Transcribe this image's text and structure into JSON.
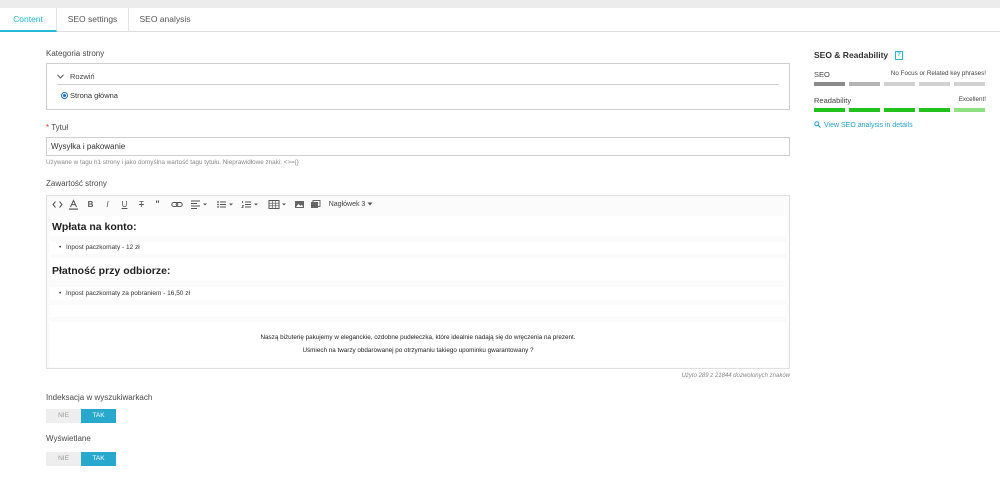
{
  "tabs": [
    "Content",
    "SEO settings",
    "SEO analysis"
  ],
  "active_tab": 0,
  "category": {
    "label": "Kategoria strony",
    "toggle_label": "Rozwiń",
    "selected_node": "Strona główna"
  },
  "title_field": {
    "label": "Tytuł",
    "required_mark": "*",
    "value": "Wysyłka i pakowanie",
    "help": "Używane w tagu h1 strony i jako domyślna wartość tagu tytułu. Nieprawidłowe znaki: <>={}"
  },
  "content_field": {
    "label": "Zawartość strony",
    "toolbar_heading": "Nagłówek 3",
    "toolbar_icons": [
      "code-icon",
      "text-color-icon",
      "bold-icon",
      "italic-icon",
      "underline-icon",
      "strikethrough-icon",
      "quote-icon",
      "link-icon",
      "align-icon",
      "bullet-list-icon",
      "numbered-list-icon",
      "table-icon",
      "image-icon",
      "media-icon"
    ],
    "heading_1": "Wpłata na konto:",
    "item_1": "Inpost paczkomaty - 12 zł",
    "heading_2": "Płatność przy odbiorze:",
    "item_2": "Inpost paczkomaty za pobraniem - 16,50 zł",
    "paragraph_1": "Naszą biżuterię pakujemy w eleganckie, ozdobne pudełeczka, które idealnie nadają się do wręczenia na prezent.",
    "paragraph_2": "Uśmiech na twarzy obdarowanej po otrzymaniu takiego upominku gwarantowany ?",
    "counter": "Użyto 289 z 21844 dozwolonych znaków"
  },
  "indexing": {
    "label": "Indeksacja w wyszukiwarkach",
    "off_label": "NIE",
    "on_label": "TAK",
    "value": "TAK"
  },
  "displayed": {
    "label": "Wyświetlane",
    "off_label": "NIE",
    "on_label": "TAK",
    "value": "TAK"
  },
  "seo_panel": {
    "title": "SEO & Readability",
    "help_icon": "?",
    "seo_label": "SEO",
    "seo_status": "No Focus or Related key phrases!",
    "readability_label": "Readability",
    "readability_status": "Excellent!",
    "link_label": "View SEO analysis in details",
    "colors": {
      "seo_bars": [
        "#8a8a8a",
        "#b3b3b3",
        "#d2d2d2",
        "#d2d2d2",
        "#d2d2d2"
      ],
      "readability_bars": [
        "#22c01a",
        "#22c01a",
        "#22c01a",
        "#22c01a",
        "#8fe082"
      ],
      "accent": "#25b9d7",
      "toggle_on": "#27a8cc"
    }
  }
}
